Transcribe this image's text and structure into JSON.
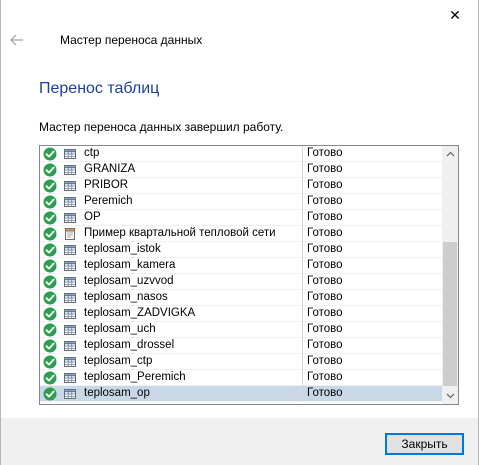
{
  "window": {
    "close_glyph": "✕"
  },
  "header": {
    "back_icon": "arrow-left-icon",
    "wizard_title": "Мастер переноса данных"
  },
  "page": {
    "section_title": "Перенос таблиц",
    "status_text": "Мастер переноса данных завершил работу."
  },
  "list": {
    "colors": {
      "ok": "#2e9e4e",
      "selected_bg": "#c8d8e6"
    },
    "rows": [
      {
        "name": "ctp",
        "result": "Готово",
        "type": "table"
      },
      {
        "name": "GRANIZA",
        "result": "Готово",
        "type": "table"
      },
      {
        "name": "PRIBOR",
        "result": "Готово",
        "type": "table"
      },
      {
        "name": "Peremich",
        "result": "Готово",
        "type": "table"
      },
      {
        "name": "OP",
        "result": "Готово",
        "type": "table"
      },
      {
        "name": "Пример квартальной тепловой сети",
        "result": "Готово",
        "type": "document"
      },
      {
        "name": "teplosam_istok",
        "result": "Готово",
        "type": "table"
      },
      {
        "name": "teplosam_kamera",
        "result": "Готово",
        "type": "table"
      },
      {
        "name": "teplosam_uzvvod",
        "result": "Готово",
        "type": "table"
      },
      {
        "name": "teplosam_nasos",
        "result": "Готово",
        "type": "table"
      },
      {
        "name": "teplosam_ZADVIGKA",
        "result": "Готово",
        "type": "table"
      },
      {
        "name": "teplosam_uch",
        "result": "Готово",
        "type": "table"
      },
      {
        "name": "teplosam_drossel",
        "result": "Готово",
        "type": "table"
      },
      {
        "name": "teplosam_ctp",
        "result": "Готово",
        "type": "table"
      },
      {
        "name": "teplosam_Peremich",
        "result": "Готово",
        "type": "table"
      },
      {
        "name": "teplosam_op",
        "result": "Готово",
        "type": "table",
        "selected": true
      }
    ]
  },
  "footer": {
    "close_button_label": "Закрыть"
  }
}
